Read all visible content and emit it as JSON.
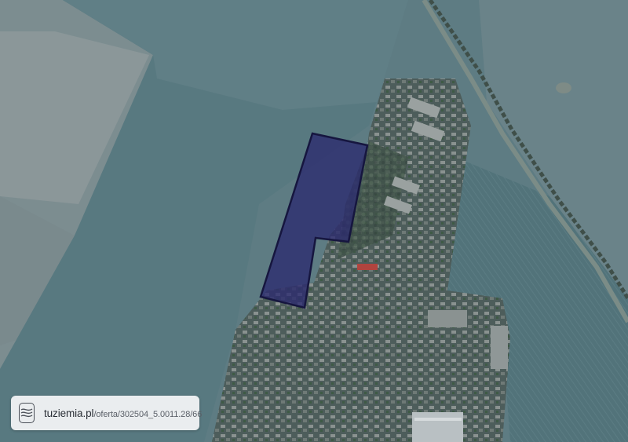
{
  "map": {
    "type": "satellite",
    "highlighted_parcel": {
      "fill": "#2b2a6e",
      "stroke": "#1a1a4a"
    }
  },
  "attribution": {
    "site": "tuziemia.pl",
    "path": "/oferta/302504_5.0011.28/66",
    "logo_icon": "contour-lines-icon"
  },
  "colors": {
    "field_light": "#7d9298",
    "field_dark": "#56747b",
    "village": "#4e5f5e",
    "badge_bg": "#f5f6f7"
  }
}
